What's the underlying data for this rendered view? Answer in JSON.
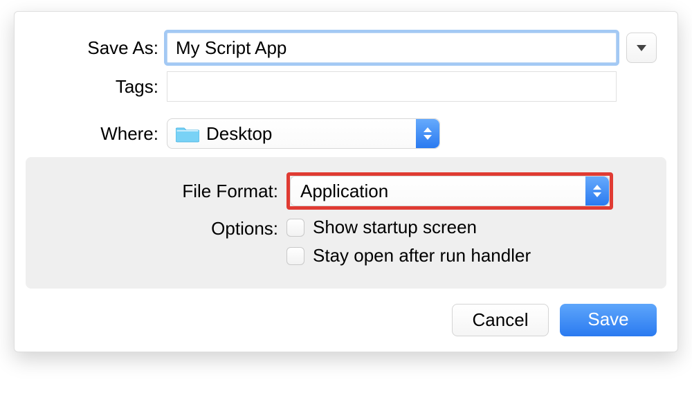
{
  "dialog": {
    "save_as_label": "Save As:",
    "save_as_value": "My Script App",
    "tags_label": "Tags:",
    "tags_value": "",
    "where_label": "Where:",
    "where_value": "Desktop"
  },
  "options": {
    "file_format_label": "File Format:",
    "file_format_value": "Application",
    "options_label": "Options:",
    "checkbox_show_startup": "Show startup screen",
    "checkbox_stay_open": "Stay open after run handler"
  },
  "footer": {
    "cancel": "Cancel",
    "save": "Save"
  }
}
